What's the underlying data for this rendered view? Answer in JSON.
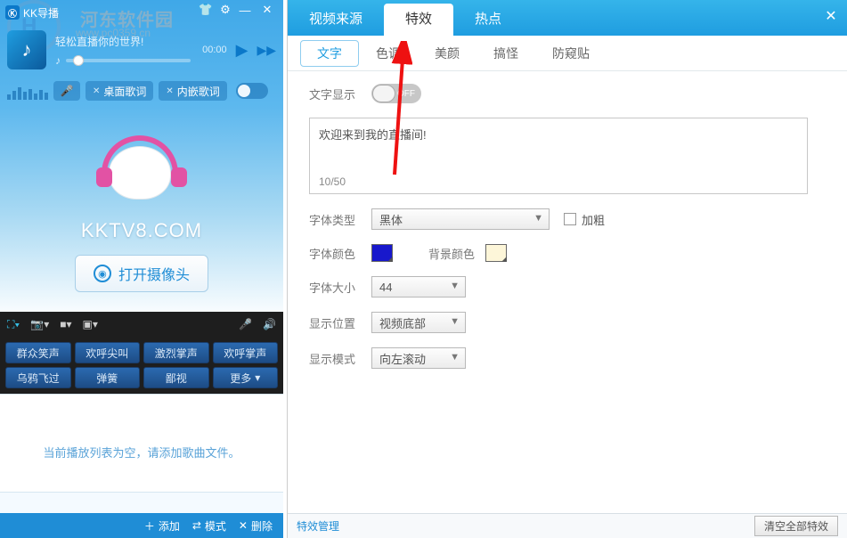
{
  "titlebar": {
    "app_name": "KK导播"
  },
  "watermark": {
    "line1": "河东软件园",
    "line2": "www.pc0359.cn"
  },
  "player": {
    "slogan": "轻松直播你的世界!",
    "time": "00:00"
  },
  "lyrics": {
    "desktop": "桌面歌词",
    "embed": "内嵌歌词"
  },
  "domain_text": "KKTV8.COM",
  "open_camera": "打开摄像头",
  "sound_effects": [
    "群众笑声",
    "欢呼尖叫",
    "激烈掌声",
    "欢呼掌声",
    "乌鸦飞过",
    "弹簧",
    "鄙视"
  ],
  "sound_more": "更多",
  "playlist_empty": "当前播放列表为空，请添加歌曲文件。",
  "bottom": {
    "add": "添加",
    "mode": "模式",
    "delete": "删除"
  },
  "right": {
    "tabs": [
      "视频来源",
      "特效",
      "热点"
    ],
    "active_tab": "特效",
    "subtabs": [
      "文字",
      "色调",
      "美颜",
      "搞怪",
      "防窥贴"
    ],
    "active_subtab": "文字",
    "close": "✕"
  },
  "form": {
    "text_display_label": "文字显示",
    "toggle_off": "OFF",
    "editor_text": "欢迎来到我的直播间!",
    "editor_counter": "10/50",
    "font_type_label": "字体类型",
    "font_type_value": "黑体",
    "bold_label": "加粗",
    "font_color_label": "字体颜色",
    "bg_color_label": "背景颜色",
    "font_size_label": "字体大小",
    "font_size_value": "44",
    "position_label": "显示位置",
    "position_value": "视频底部",
    "mode_label": "显示模式",
    "mode_value": "向左滚动"
  },
  "footer": {
    "manage": "特效管理",
    "clear": "清空全部特效"
  }
}
